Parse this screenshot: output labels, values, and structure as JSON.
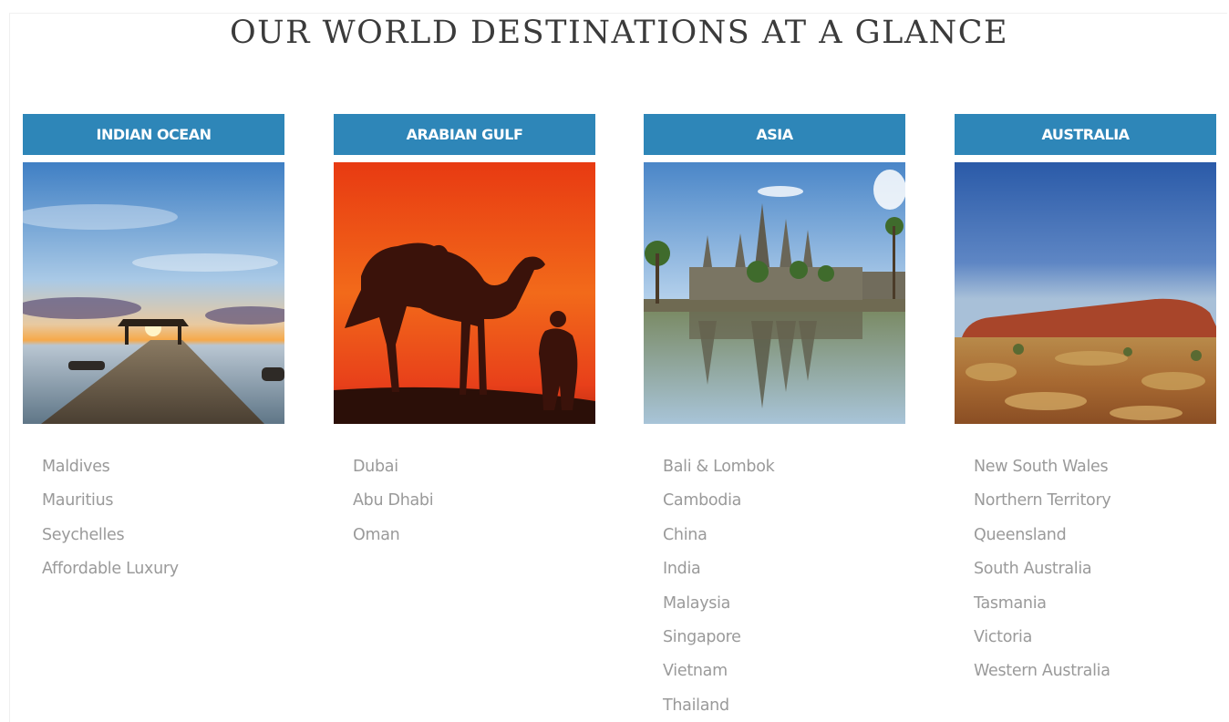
{
  "page": {
    "title": "OUR WORLD DESTINATIONS AT A GLANCE"
  },
  "regions": [
    {
      "name": "INDIAN OCEAN",
      "image_subject": "sunset over jetty with thatched hut",
      "destinations": [
        "Maldives",
        "Mauritius",
        "Seychelles",
        "Affordable Luxury"
      ]
    },
    {
      "name": "ARABIAN GULF",
      "image_subject": "camel and rider silhouette against red sunset",
      "destinations": [
        "Dubai",
        "Abu Dhabi",
        "Oman"
      ]
    },
    {
      "name": "ASIA",
      "image_subject": "Angkor Wat temple reflected in water",
      "destinations": [
        "Bali & Lombok",
        "Cambodia",
        "China",
        "India",
        "Malaysia",
        "Singapore",
        "Vietnam",
        "Thailand"
      ]
    },
    {
      "name": "AUSTRALIA",
      "image_subject": "Uluru rock in outback desert",
      "destinations": [
        "New South Wales",
        "Northern Territory",
        "Queensland",
        "South Australia",
        "Tasmania",
        "Victoria",
        "Western Australia"
      ]
    }
  ],
  "colors": {
    "header_bg": "#2e86b8",
    "header_text": "#ffffff",
    "list_text": "#9a9a9a",
    "title_text": "#3b3b3b"
  }
}
